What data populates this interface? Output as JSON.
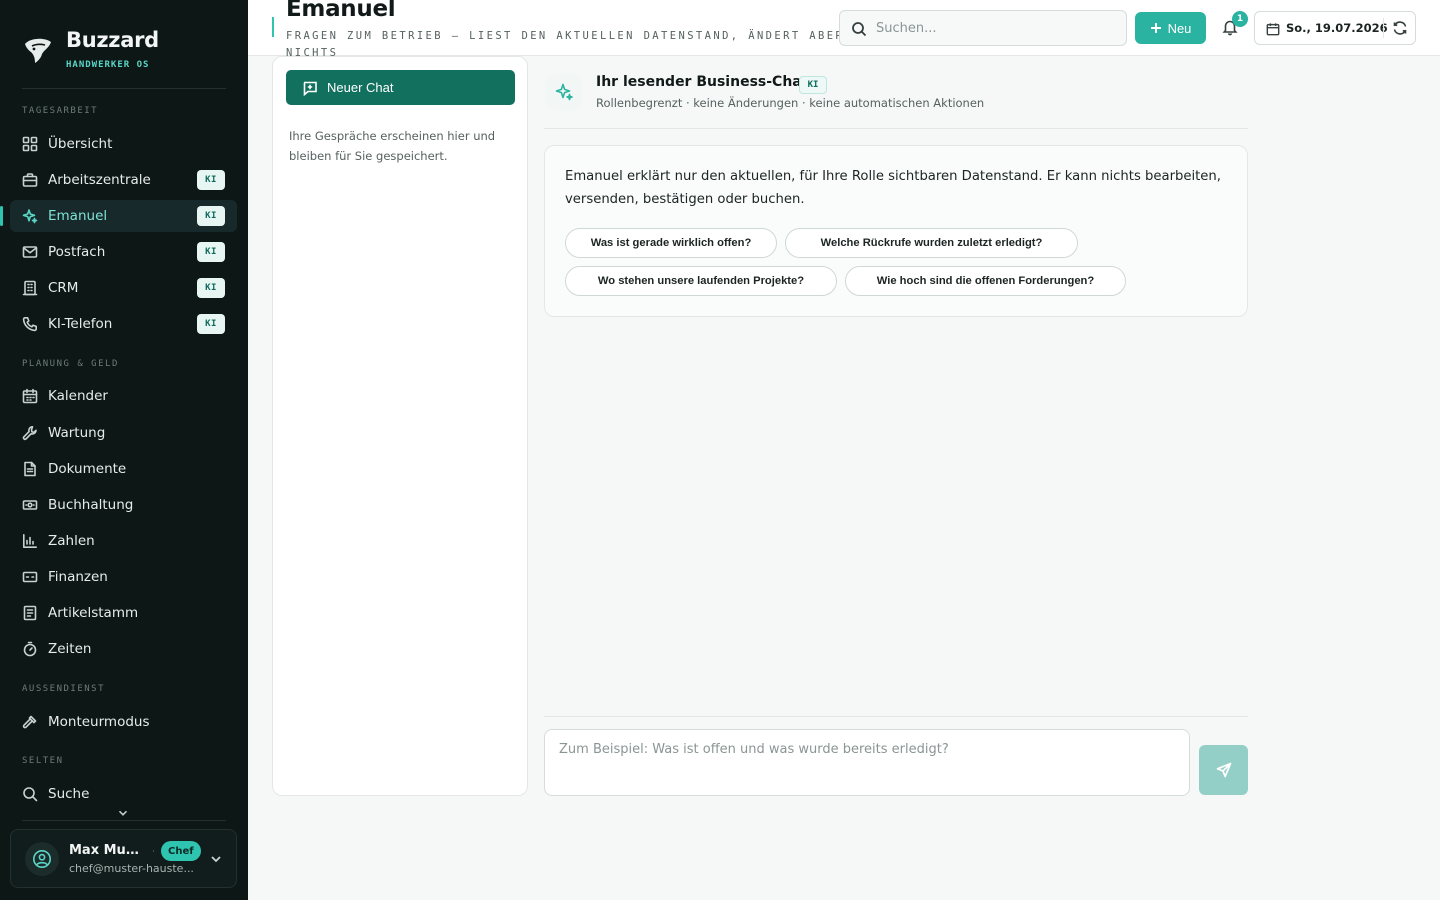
{
  "brand": {
    "name": "Buzzard",
    "tagline": "HANDWERKER OS",
    "logo_icon": "buzzard-logo"
  },
  "sidebar": {
    "sections": {
      "daily": "TAGESARBEIT",
      "planning": "PLANUNG & GELD",
      "field": "AUSSENDIENST",
      "rare": "SELTEN"
    },
    "items": [
      {
        "label": "Übersicht",
        "icon": "grid-icon",
        "badge": null
      },
      {
        "label": "Arbeitszentrale",
        "icon": "briefcase-icon",
        "badge": "KI"
      },
      {
        "label": "Emanuel",
        "icon": "sparkles-icon",
        "badge": "KI",
        "active": true
      },
      {
        "label": "Postfach",
        "icon": "mail-icon",
        "badge": "KI"
      },
      {
        "label": "CRM",
        "icon": "building-icon",
        "badge": "KI"
      },
      {
        "label": "KI-Telefon",
        "icon": "phone-icon",
        "badge": "KI"
      },
      {
        "label": "Kalender",
        "icon": "calendar-icon",
        "badge": null
      },
      {
        "label": "Wartung",
        "icon": "wrench-icon",
        "badge": null
      },
      {
        "label": "Dokumente",
        "icon": "document-icon",
        "badge": null
      },
      {
        "label": "Buchhaltung",
        "icon": "banknote-icon",
        "badge": null
      },
      {
        "label": "Zahlen",
        "icon": "bar-chart-icon",
        "badge": null
      },
      {
        "label": "Finanzen",
        "icon": "wallet-icon",
        "badge": null
      },
      {
        "label": "Artikelstamm",
        "icon": "list-icon",
        "badge": null
      },
      {
        "label": "Zeiten",
        "icon": "timer-icon",
        "badge": null
      },
      {
        "label": "Monteurmodus",
        "icon": "hammer-icon",
        "badge": null
      },
      {
        "label": "Suche",
        "icon": "search-icon",
        "badge": null
      }
    ]
  },
  "user": {
    "name": "Max Mus...",
    "role": "Chef",
    "email": "chef@muster-hauste..."
  },
  "header": {
    "title": "Emanuel",
    "subtitle": "FRAGEN ZUM BETRIEB – LIEST DEN AKTUELLEN DATENSTAND, ÄNDERT ABER NICHTS",
    "search_placeholder": "Suchen...",
    "new_label": "Neu",
    "notification_count": "1",
    "date": "So., 19.07.2026"
  },
  "chat_list": {
    "new_chat_label": "Neuer Chat",
    "empty_text": "Ihre Gespräche erscheinen hier und bleiben für Sie gespeichert."
  },
  "chat": {
    "title": "Ihr lesender Business-Chat",
    "badge": "KI",
    "meta": "Rollenbegrenzt · keine Änderungen · keine automatischen Aktionen",
    "intro": "Emanuel erklärt nur den aktuellen, für Ihre Rolle sichtbaren Datenstand. Er kann nichts bearbeiten, versenden, bestätigen oder buchen.",
    "suggestions": [
      "Was ist gerade wirklich offen?",
      "Welche Rückrufe wurden zuletzt erledigt?",
      "Wo stehen unsere laufenden Projekte?",
      "Wie hoch sind die offenen Forderungen?"
    ],
    "input_placeholder": "Zum Beispiel: Was ist offen und was wurde bereits erledigt?"
  },
  "colors": {
    "accent": "#2bb3a1",
    "primary_dark": "#12705f",
    "sidebar_bg": "#0c1716"
  }
}
